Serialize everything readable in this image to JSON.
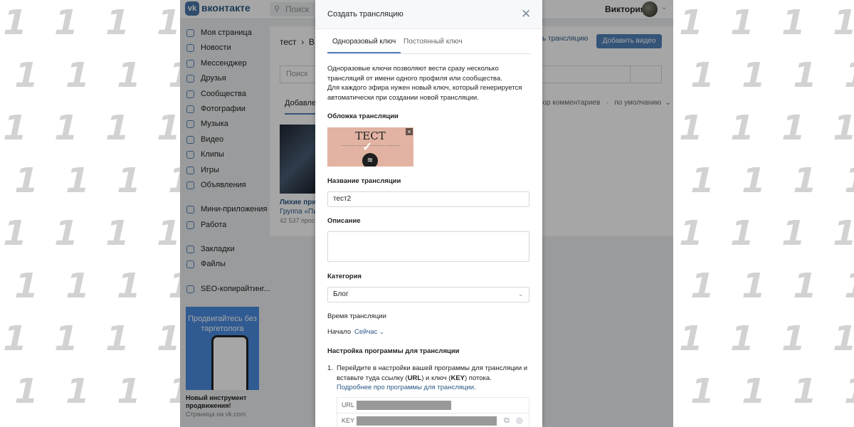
{
  "topbar": {
    "logo_icon": "vk",
    "logo": "вконтакте",
    "search_placeholder": "Поиск",
    "user_name": "Виктория"
  },
  "sidebar": {
    "items": [
      {
        "label": "Моя страница",
        "icon": "user-icon"
      },
      {
        "label": "Новости",
        "icon": "news-icon"
      },
      {
        "label": "Мессенджер",
        "icon": "message-icon"
      },
      {
        "label": "Друзья",
        "icon": "friends-icon"
      },
      {
        "label": "Сообщества",
        "icon": "communities-icon"
      },
      {
        "label": "Фотографии",
        "icon": "photo-icon"
      },
      {
        "label": "Музыка",
        "icon": "music-icon"
      },
      {
        "label": "Видео",
        "icon": "video-icon"
      },
      {
        "label": "Клипы",
        "icon": "clips-icon"
      },
      {
        "label": "Игры",
        "icon": "games-icon"
      },
      {
        "label": "Объявления",
        "icon": "ads-icon"
      }
    ],
    "items2": [
      {
        "label": "Мини-приложения",
        "icon": "apps-icon"
      },
      {
        "label": "Работа",
        "icon": "work-icon"
      }
    ],
    "items3": [
      {
        "label": "Закладки",
        "icon": "bookmark-icon"
      },
      {
        "label": "Файлы",
        "icon": "file-icon"
      }
    ],
    "items4": [
      {
        "label": "SEO-копирайтинг...",
        "icon": "group-icon"
      }
    ],
    "promo": {
      "title": "Продвигайтесь без таргетолога",
      "caption": "Новый инструмент продвижения!",
      "source": "Страница на vk.com"
    }
  },
  "content": {
    "breadcrumb": "тест",
    "breadcrumb_next": "В",
    "btn_broadcast": "ь трансляцию",
    "btn_add_video": "Добавить видео",
    "search_placeholder": "Поиск",
    "tab": "Добавлен",
    "right_filter": "зор комментариев",
    "sort": "по умолчанию",
    "video": {
      "title": "Лихие приш",
      "group": "Группа «Пи",
      "views": "42 537 прос"
    }
  },
  "modal": {
    "title": "Создать трансляцию",
    "tabs": [
      "Одноразовый ключ",
      "Постоянный ключ"
    ],
    "description": "Одноразовые ключи позволяют вести сразу несколько трансляций от имени одного профиля или сообщества.\nДля каждого эфира нужен новый ключ, который генерируется автоматически при создании новой трансляции.",
    "cover_label": "Обложка трансляции",
    "cover_text": "ТЕСТ",
    "name_label": "Название трансляции",
    "name_value": "тест2",
    "description_label": "Описание",
    "category_label": "Категория",
    "category_value": "Блог",
    "time_label": "Время трансляции",
    "start_label": "Начало",
    "start_value": "Сейчас",
    "settings_label": "Настройка программы для трансляции",
    "step1_number": "1.",
    "step1_pre": "Перейдите в настройки вашей программы для трансляции и вставьте туда ссылку (",
    "step1_url": "URL",
    "step1_mid": ") и ключ (",
    "step1_key": "KEY",
    "step1_post": ") потока.",
    "step1_link": "Подробнее про программы для трансляции.",
    "url_label": "URL",
    "key_label": "KEY"
  },
  "colors": {
    "accent": "#5181b8",
    "link": "#2a5885",
    "background": "#edeef0",
    "watermark": "#d2d2d2"
  }
}
